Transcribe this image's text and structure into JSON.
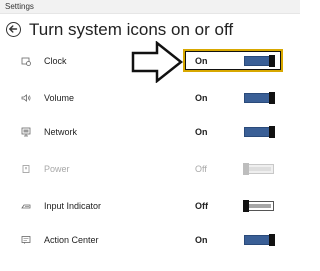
{
  "window": {
    "title": "Settings"
  },
  "header": {
    "title": "Turn system icons on or off"
  },
  "items": [
    {
      "label": "Clock",
      "state": "On",
      "enabled": true,
      "icon": "clock-icon"
    },
    {
      "label": "Volume",
      "state": "On",
      "enabled": true,
      "icon": "volume-icon"
    },
    {
      "label": "Network",
      "state": "On",
      "enabled": true,
      "icon": "network-icon"
    },
    {
      "label": "Power",
      "state": "Off",
      "enabled": false,
      "icon": "power-icon"
    },
    {
      "label": "Input Indicator",
      "state": "Off",
      "enabled": true,
      "icon": "keyboard-icon"
    },
    {
      "label": "Action Center",
      "state": "On",
      "enabled": true,
      "icon": "action-center-icon"
    }
  ],
  "colors": {
    "toggle_on": "#3a5f96",
    "highlight": "#d8a800"
  }
}
